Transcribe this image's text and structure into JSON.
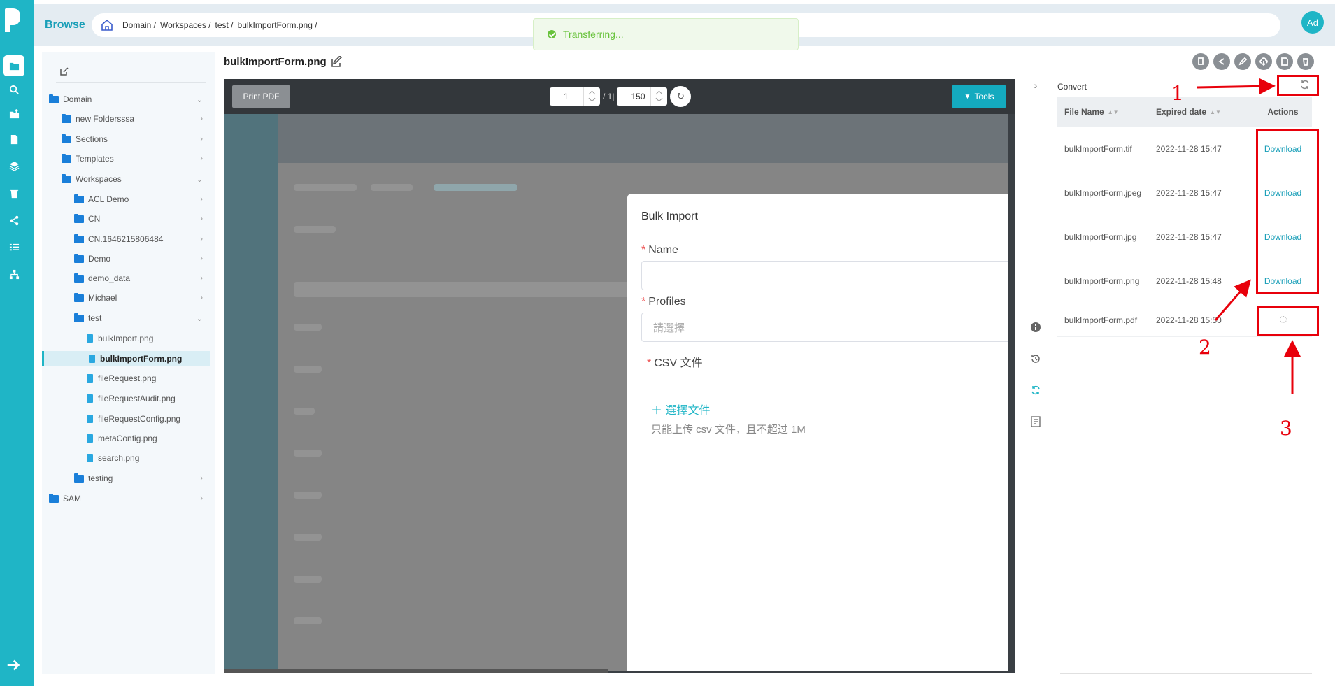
{
  "app": {
    "brand": "Browse",
    "avatar": "Ad"
  },
  "breadcrumb": [
    "Domain /",
    "Workspaces /",
    "test /",
    "bulkImportForm.png /"
  ],
  "toast": "Transferring...",
  "tree": [
    {
      "label": "Domain",
      "kind": "folder",
      "chev": "⌄"
    },
    {
      "label": "new Foldersssa",
      "kind": "folder",
      "chev": "›"
    },
    {
      "label": "Sections",
      "kind": "folder",
      "chev": "›"
    },
    {
      "label": "Templates",
      "kind": "folder",
      "chev": "›"
    },
    {
      "label": "Workspaces",
      "kind": "folder",
      "chev": "⌄"
    },
    {
      "label": "ACL Demo",
      "kind": "folder",
      "chev": "›"
    },
    {
      "label": "CN",
      "kind": "folder",
      "chev": "›"
    },
    {
      "label": "CN.1646215806484",
      "kind": "folder",
      "chev": "›"
    },
    {
      "label": "Demo",
      "kind": "folder",
      "chev": "›"
    },
    {
      "label": "demo_data",
      "kind": "folder",
      "chev": "›"
    },
    {
      "label": "Michael",
      "kind": "folder",
      "chev": "›"
    },
    {
      "label": "test",
      "kind": "folder",
      "chev": "⌄"
    },
    {
      "label": "bulkImport.png",
      "kind": "file",
      "chev": ""
    },
    {
      "label": "bulkImportForm.png",
      "kind": "file",
      "chev": ""
    },
    {
      "label": "fileRequest.png",
      "kind": "file",
      "chev": ""
    },
    {
      "label": "fileRequestAudit.png",
      "kind": "file",
      "chev": ""
    },
    {
      "label": "fileRequestConfig.png",
      "kind": "file",
      "chev": ""
    },
    {
      "label": "metaConfig.png",
      "kind": "file",
      "chev": ""
    },
    {
      "label": "search.png",
      "kind": "file",
      "chev": ""
    },
    {
      "label": "testing",
      "kind": "folder",
      "chev": "›"
    },
    {
      "label": "SAM",
      "kind": "folder",
      "chev": "›"
    }
  ],
  "doc_title": "bulkImportForm.png",
  "viewer": {
    "print_label": "Print PDF",
    "page_current": "1",
    "page_sep": "/ 1|",
    "zoom": "150",
    "refresh_glyph": "↻",
    "tools_label": "Tools"
  },
  "modal": {
    "title": "Bulk Import",
    "name_label": "Name",
    "profiles_label": "Profiles",
    "profiles_placeholder": "請選擇",
    "csv_label": "CSV 文件",
    "choose_file": "＋ 選擇文件",
    "hint": "只能上传 csv 文件，且不超过 1M",
    "required_mark": "*"
  },
  "convert": {
    "label": "Convert",
    "headers": {
      "file": "File Name",
      "expired": "Expired date",
      "actions": "Actions"
    },
    "sort_glyph": "▲▼",
    "rows": [
      {
        "file": "bulkImportForm.tif",
        "date": "2022-11-28 15:47",
        "action": "Download"
      },
      {
        "file": "bulkImportForm.jpeg",
        "date": "2022-11-28 15:47",
        "action": "Download"
      },
      {
        "file": "bulkImportForm.jpg",
        "date": "2022-11-28 15:47",
        "action": "Download"
      },
      {
        "file": "bulkImportForm.png",
        "date": "2022-11-28 15:48",
        "action": "Download"
      },
      {
        "file": "bulkImportForm.pdf",
        "date": "2022-11-28 15:50",
        "action": ""
      }
    ]
  },
  "annotations": {
    "n1": "1",
    "n2": "2",
    "n3": "3",
    "color": "#e8000b"
  },
  "colors": {
    "accent": "#1fb5c6",
    "link": "#1a9fb8",
    "success": "#67c23a"
  }
}
